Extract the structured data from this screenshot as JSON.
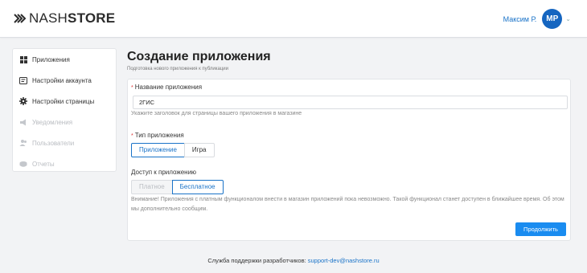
{
  "header": {
    "logo_part1": "NASH",
    "logo_part2": "STORE",
    "user_name": "Максим Р.",
    "user_initials": "МР"
  },
  "sidebar": {
    "items": [
      {
        "label": "Приложения",
        "icon": "grid-icon",
        "enabled": true
      },
      {
        "label": "Настройки аккаунта",
        "icon": "id-card-icon",
        "enabled": true
      },
      {
        "label": "Настройки страницы",
        "icon": "gear-icon",
        "enabled": true
      },
      {
        "label": "Уведомления",
        "icon": "megaphone-icon",
        "enabled": false
      },
      {
        "label": "Пользователи",
        "icon": "users-icon",
        "enabled": false
      },
      {
        "label": "Отчеты",
        "icon": "report-icon",
        "enabled": false
      }
    ]
  },
  "main": {
    "title": "Создание приложения",
    "subtitle": "Подготовка нового приложения к публикации",
    "app_name_label": "Название приложения",
    "app_name_value": "2ГИС",
    "app_name_hint": "Укажите заголовок для страницы вашего приложения в магазине",
    "app_type_label": "Тип приложения",
    "app_type_options": [
      "Приложение",
      "Игра"
    ],
    "app_type_selected": "Приложение",
    "access_label": "Доступ к приложению",
    "access_options": [
      "Платное",
      "Бесплатное"
    ],
    "access_selected": "Бесплатное",
    "access_warning": "Внимание! Приложения с платным функционалом внести в магазин приложений пока невозможно. Такой функционал станет доступен в ближайшее время. Об этом мы дополнительно сообщим.",
    "continue_label": "Продолжить"
  },
  "footer": {
    "text": "Служба поддержки разработчиков:",
    "email": "support-dev@nashstore.ru"
  },
  "colors": {
    "accent": "#1a73c8",
    "primary_button": "#1a8cf0",
    "avatar": "#1565c0",
    "background": "#f2f3f5"
  }
}
